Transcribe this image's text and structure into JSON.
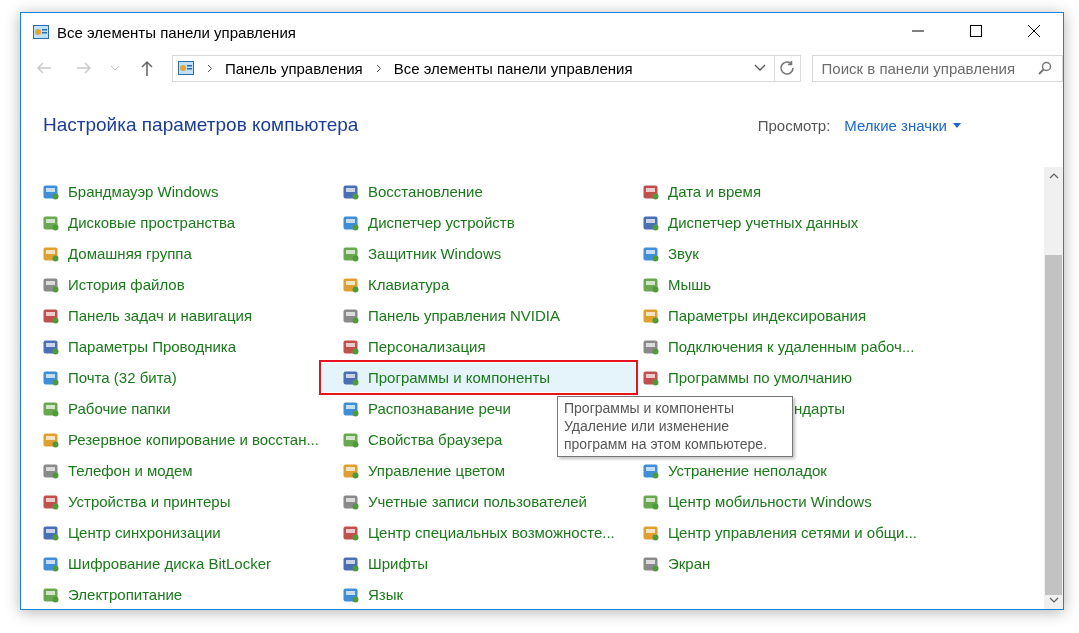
{
  "window": {
    "title": "Все элементы панели управления"
  },
  "address_bar": {
    "path": [
      "Панель управления",
      "Все элементы панели управления"
    ]
  },
  "search": {
    "placeholder": "Поиск в панели управления"
  },
  "heading": "Настройка параметров компьютера",
  "view": {
    "label": "Просмотр:",
    "value": "Мелкие значки"
  },
  "columns": [
    [
      {
        "label": "Брандмауэр Windows",
        "selected": false
      },
      {
        "label": "Дисковые пространства",
        "selected": false
      },
      {
        "label": "Домашняя группа",
        "selected": false
      },
      {
        "label": "История файлов",
        "selected": false
      },
      {
        "label": "Панель задач и навигация",
        "selected": false
      },
      {
        "label": "Параметры Проводника",
        "selected": false
      },
      {
        "label": "Почта (32 бита)",
        "selected": false
      },
      {
        "label": "Рабочие папки",
        "selected": false
      },
      {
        "label": "Резервное копирование и восстан...",
        "selected": false
      },
      {
        "label": "Телефон и модем",
        "selected": false
      },
      {
        "label": "Устройства и принтеры",
        "selected": false
      },
      {
        "label": "Центр синхронизации",
        "selected": false
      },
      {
        "label": "Шифрование диска BitLocker",
        "selected": false
      },
      {
        "label": "Электропитание",
        "selected": false
      }
    ],
    [
      {
        "label": "Восстановление",
        "selected": false
      },
      {
        "label": "Диспетчер устройств",
        "selected": false
      },
      {
        "label": "Защитник Windows",
        "selected": false
      },
      {
        "label": "Клавиатура",
        "selected": false
      },
      {
        "label": "Панель управления NVIDIA",
        "selected": false
      },
      {
        "label": "Персонализация",
        "selected": false
      },
      {
        "label": "Программы и компоненты",
        "selected": true
      },
      {
        "label": "Распознавание речи",
        "selected": false
      },
      {
        "label": "Свойства браузера",
        "selected": false
      },
      {
        "label": "Управление цветом",
        "selected": false
      },
      {
        "label": "Учетные записи пользователей",
        "selected": false
      },
      {
        "label": "Центр специальных возможносте...",
        "selected": false
      },
      {
        "label": "Шрифты",
        "selected": false
      },
      {
        "label": "Язык",
        "selected": false
      }
    ],
    [
      {
        "label": "Дата и время",
        "selected": false
      },
      {
        "label": "Диспетчер учетных данных",
        "selected": false
      },
      {
        "label": "Звук",
        "selected": false
      },
      {
        "label": "Мышь",
        "selected": false
      },
      {
        "label": "Параметры индексирования",
        "selected": false
      },
      {
        "label": "Подключения к удаленным рабоч...",
        "selected": false
      },
      {
        "label": "Программы по умолчанию",
        "selected": false
      },
      {
        "label": "ндарты",
        "selected": false,
        "covered": true
      },
      {
        "label": "Устранение неполадок",
        "selected": false
      },
      {
        "label": "Центр мобильности Windows",
        "selected": false
      },
      {
        "label": "Центр управления сетями и общи...",
        "selected": false
      },
      {
        "label": "Экран",
        "selected": false
      }
    ]
  ],
  "tooltip": [
    "Программы и компоненты",
    "Удаление или изменение",
    "программ на этом компьютере."
  ]
}
